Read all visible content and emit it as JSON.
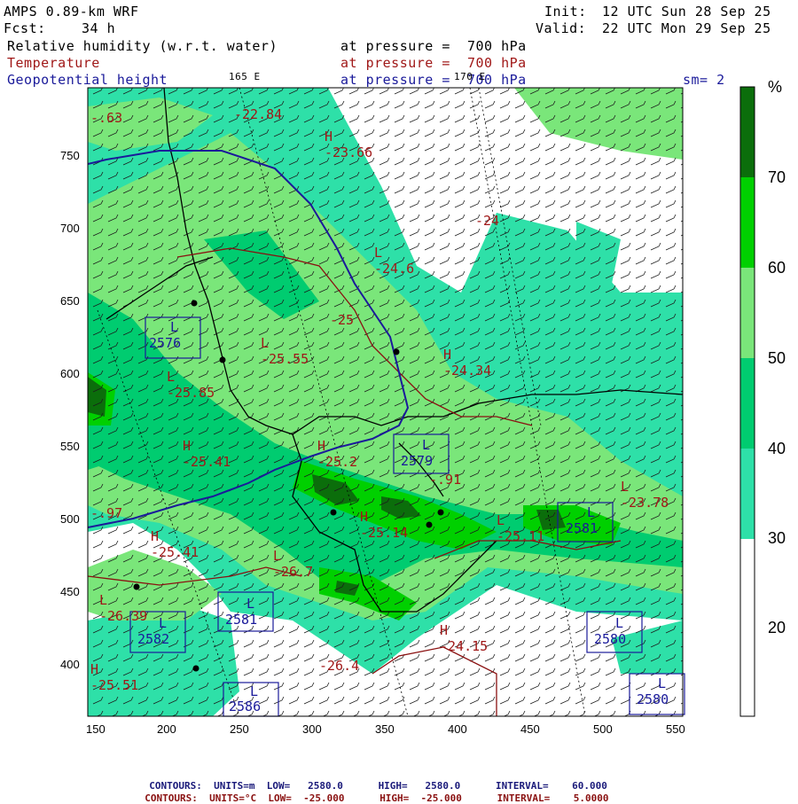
{
  "header": {
    "model": "AMPS 0.89-km WRF",
    "forecast_label": "Fcst:",
    "forecast_value": "34 h",
    "init_label": "Init:",
    "init_value": "12 UTC Sun 28 Sep 25",
    "valid_label": "Valid:",
    "valid_value": "22 UTC Mon 29 Sep 25",
    "fields": [
      {
        "name": "Relative humidity (w.r.t. water)",
        "level": "at pressure =  700 hPa"
      },
      {
        "name": "Temperature",
        "level": "at pressure =  700 hPa"
      },
      {
        "name": "Geopotential height",
        "level": "at pressure =  700 hPa"
      }
    ],
    "smoothing": "sm= 2",
    "meridian_165": "165 E",
    "meridian_170": "170 E"
  },
  "axes": {
    "x_ticks": [
      "150",
      "200",
      "250",
      "300",
      "350",
      "400",
      "450",
      "500",
      "550"
    ],
    "y_ticks": [
      "750",
      "700",
      "650",
      "600",
      "550",
      "500",
      "450",
      "400"
    ]
  },
  "colorbar": {
    "unit": "%",
    "labels": [
      "70",
      "60",
      "50",
      "40",
      "30",
      "20"
    ],
    "colors": [
      "#0b6e0b",
      "#00d000",
      "#7ae67a",
      "#00cc70",
      "#2ee0a8",
      "#ffffff"
    ]
  },
  "map_labels": {
    "highs_lows": [
      {
        "sym": "L",
        "val": "2576"
      },
      {
        "sym": "L",
        "val": "2579"
      },
      {
        "sym": "L",
        "val": "2581"
      },
      {
        "sym": "L",
        "val": "2581"
      },
      {
        "sym": "L",
        "val": "2582"
      },
      {
        "sym": "L",
        "val": "2586"
      },
      {
        "sym": "L",
        "val": "2580"
      },
      {
        "sym": "L",
        "val": "2580"
      }
    ],
    "temps": [
      {
        "sym": "H",
        "val": "-23.66"
      },
      {
        "sym": "L",
        "val": "-24.6"
      },
      {
        "sym": "",
        "val": "-25"
      },
      {
        "sym": "H",
        "val": "-24.34"
      },
      {
        "sym": "L",
        "val": "-25.55"
      },
      {
        "sym": "L",
        "val": "-25.85"
      },
      {
        "sym": "H",
        "val": "-25.41"
      },
      {
        "sym": "H",
        "val": "-25.2"
      },
      {
        "sym": "H",
        "val": "-25.14"
      },
      {
        "sym": "L",
        "val": "-25.11"
      },
      {
        "sym": "L",
        "val": "-23.78"
      },
      {
        "sym": "H",
        "val": "-25.41"
      },
      {
        "sym": "L",
        "val": "-26.7"
      },
      {
        "sym": "L",
        "val": "-26.39"
      },
      {
        "sym": "H",
        "val": "-24.15"
      },
      {
        "sym": "H",
        "val": "-25.51"
      },
      {
        "sym": "",
        "val": "-26.4"
      },
      {
        "sym": "",
        "val": "-22.84"
      },
      {
        "sym": "",
        "val": "-24"
      },
      {
        "sym": "",
        "val": "-.63"
      },
      {
        "sym": "",
        "val": "-.97"
      },
      {
        "sym": "",
        "val": "-.91"
      }
    ]
  },
  "footer": {
    "geo": {
      "label": "CONTOURS:",
      "units": "UNITS=m",
      "low": "LOW=   2580.0",
      "high": "HIGH=   2580.0",
      "interval": "INTERVAL=    60.000"
    },
    "temp": {
      "label": "CONTOURS:",
      "units": "UNITS=°C",
      "low": "LOW=  -25.000",
      "high": "HIGH=  -25.000",
      "interval": "INTERVAL=    5.0000"
    }
  }
}
